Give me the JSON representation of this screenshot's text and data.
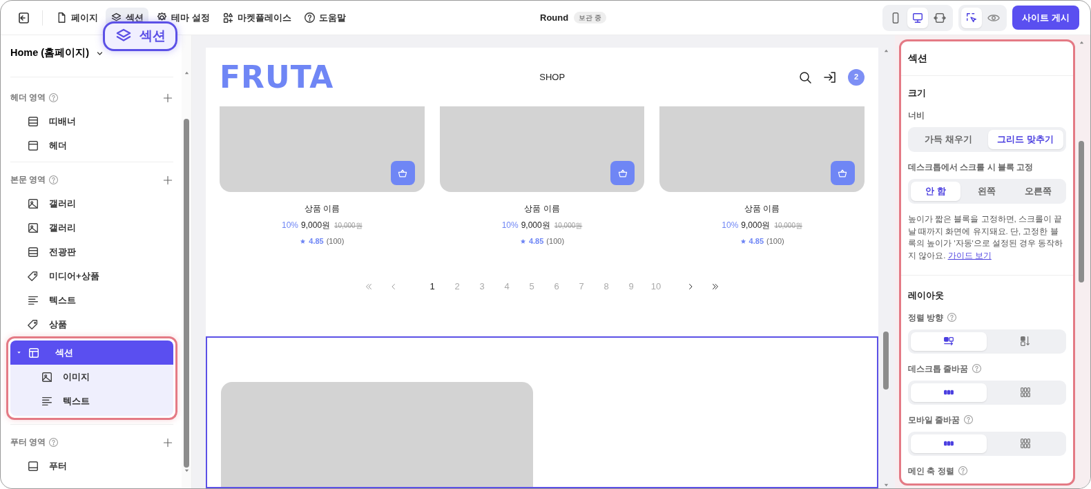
{
  "topbar": {
    "nav": [
      {
        "label": "페이지",
        "kind": "doc",
        "selected": false
      },
      {
        "label": "섹션",
        "kind": "layers",
        "selected": true
      },
      {
        "label": "테마 설정",
        "kind": "gear",
        "selected": false
      },
      {
        "label": "마켓플레이스",
        "kind": "market",
        "selected": false
      },
      {
        "label": "도움말",
        "kind": "help",
        "selected": false
      }
    ],
    "callout": {
      "label": "섹션"
    },
    "document": {
      "title": "Round",
      "badge": "보관 중"
    },
    "devices": [
      {
        "kind": "mobile",
        "selected": false
      },
      {
        "kind": "desktop",
        "selected": true
      },
      {
        "kind": "fit",
        "selected": false
      }
    ],
    "modes": [
      {
        "kind": "select",
        "selected": true
      },
      {
        "kind": "preview",
        "selected": false
      }
    ],
    "publish_button": "사이트 게시"
  },
  "sidebar": {
    "page_selector": "Home (홈페이지)",
    "groups": [
      {
        "title": "헤더 영역",
        "items": [
          {
            "label": "띠배너",
            "kind": "rows",
            "selected": false
          },
          {
            "label": "헤더",
            "kind": "window",
            "selected": false
          }
        ]
      },
      {
        "title": "본문 영역",
        "items": [
          {
            "label": "갤러리",
            "kind": "image",
            "selected": false
          },
          {
            "label": "갤러리",
            "kind": "image",
            "selected": false
          },
          {
            "label": "전광판",
            "kind": "rows",
            "selected": false
          },
          {
            "label": "미디어+상품",
            "kind": "tag",
            "selected": false
          },
          {
            "label": "텍스트",
            "kind": "text",
            "selected": false
          },
          {
            "label": "상품",
            "kind": "tag",
            "selected": false
          },
          {
            "label": "섹션",
            "kind": "layout",
            "selected": true,
            "expanded": true,
            "children": [
              {
                "label": "이미지",
                "kind": "image",
                "selected": false
              },
              {
                "label": "텍스트",
                "kind": "text",
                "selected": false
              }
            ]
          }
        ]
      },
      {
        "title": "푸터 영역",
        "items": [
          {
            "label": "푸터",
            "kind": "footer",
            "selected": false
          }
        ]
      }
    ]
  },
  "canvas": {
    "site_header": {
      "logo": "FRUTA",
      "menu": "SHOP",
      "cart_count": "2"
    },
    "products": [
      {
        "name": "상품 이름",
        "discount": "10%",
        "price": "9,000원",
        "original_price": "10,000원",
        "rating": "4.85",
        "reviews": "(100)"
      },
      {
        "name": "상품 이름",
        "discount": "10%",
        "price": "9,000원",
        "original_price": "10,000원",
        "rating": "4.85",
        "reviews": "(100)"
      },
      {
        "name": "상품 이름",
        "discount": "10%",
        "price": "9,000원",
        "original_price": "10,000원",
        "rating": "4.85",
        "reviews": "(100)"
      }
    ],
    "pagination": [
      {
        "label": "1",
        "selected": true
      },
      {
        "label": "2",
        "selected": false
      },
      {
        "label": "3",
        "selected": false
      },
      {
        "label": "4",
        "selected": false
      },
      {
        "label": "5",
        "selected": false
      },
      {
        "label": "6",
        "selected": false
      },
      {
        "label": "7",
        "selected": false
      },
      {
        "label": "8",
        "selected": false
      },
      {
        "label": "9",
        "selected": false
      },
      {
        "label": "10",
        "selected": false
      }
    ]
  },
  "panel": {
    "title": "섹션",
    "size": {
      "title": "크기",
      "width": {
        "label": "너비",
        "options": [
          {
            "label": "가득 채우기",
            "selected": false
          },
          {
            "label": "그리드 맞추기",
            "selected": true
          }
        ]
      },
      "sticky": {
        "label": "데스크톱에서 스크롤 시 블록 고정",
        "options": [
          {
            "label": "안 함",
            "selected": true
          },
          {
            "label": "왼쪽",
            "selected": false
          },
          {
            "label": "오른쪽",
            "selected": false
          }
        ]
      },
      "help": "높이가 짧은 블록을 고정하면, 스크롤이 끝날 때까지 화면에 유지돼요. 단, 고정한 블록의 높이가 '자동'으로 설정된 경우 동작하지 않아요.",
      "help_link": "가이드 보기"
    },
    "layout": {
      "title": "레이아웃",
      "fields": [
        {
          "label": "정렬 방향",
          "options": [
            {
              "kind": "dir-h",
              "selected": true
            },
            {
              "kind": "dir-v",
              "selected": false
            }
          ]
        },
        {
          "label": "데스크톱 줄바꿈",
          "options": [
            {
              "kind": "dots-row",
              "selected": true
            },
            {
              "kind": "dots-grid",
              "selected": false
            }
          ]
        },
        {
          "label": "모바일 줄바꿈",
          "options": [
            {
              "kind": "dots-row",
              "selected": true
            },
            {
              "kind": "dots-grid",
              "selected": false
            }
          ]
        }
      ],
      "next_label": "메인 축 정렬"
    }
  }
}
